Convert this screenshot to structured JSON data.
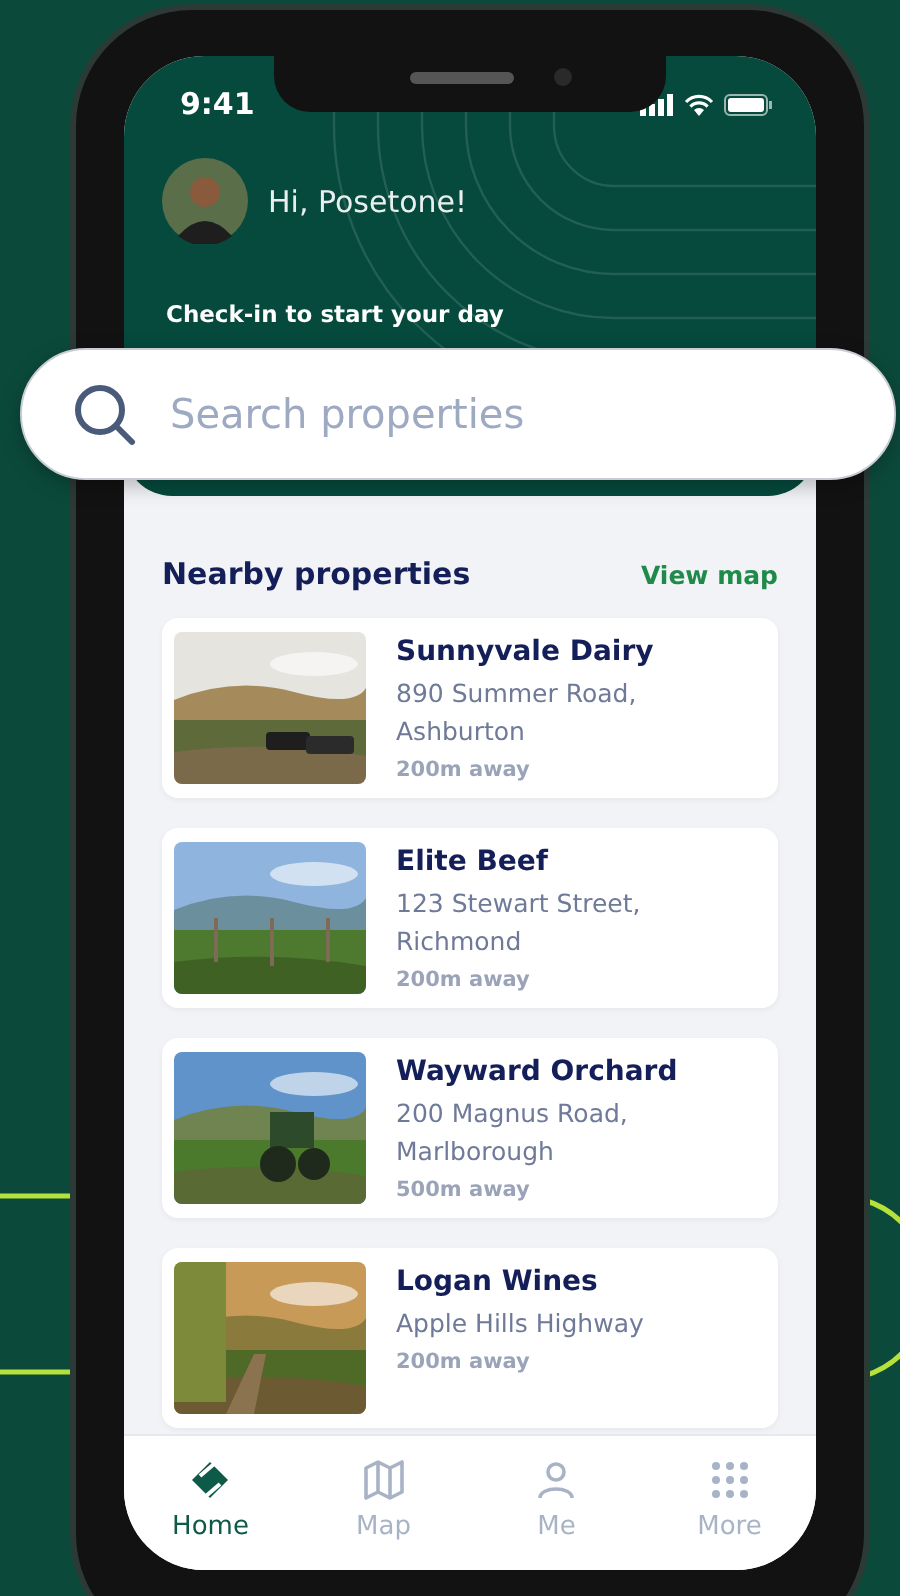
{
  "status_bar": {
    "time": "9:41"
  },
  "header": {
    "greeting": "Hi, Posetone!",
    "subtitle": "Check-in to start your day"
  },
  "search": {
    "placeholder": "Search properties"
  },
  "section": {
    "title": "Nearby properties",
    "link": "View map"
  },
  "properties": [
    {
      "name": "Sunnyvale Dairy",
      "address_lines": [
        "890 Summer Road,",
        "Ashburton"
      ],
      "distance": "200m away",
      "image": {
        "kind": "picture"
      }
    },
    {
      "name": "Elite Beef",
      "address_lines": [
        "123 Stewart Street,",
        "Richmond"
      ],
      "distance": "200m away",
      "image": {
        "kind": "picture"
      }
    },
    {
      "name": "Wayward Orchard",
      "address_lines": [
        "200 Magnus Road,",
        "Marlborough"
      ],
      "distance": "500m away",
      "image": {
        "kind": "picture"
      }
    },
    {
      "name": "Logan Wines",
      "address_lines": [
        "Apple Hills Highway"
      ],
      "distance": "200m away",
      "image": {
        "kind": "picture"
      }
    }
  ],
  "nav": [
    {
      "kind": "home",
      "label": "Home",
      "selected": true
    },
    {
      "kind": "map",
      "label": "Map",
      "selected": false
    },
    {
      "kind": "me",
      "label": "Me",
      "selected": false
    },
    {
      "kind": "more",
      "label": "More",
      "selected": false
    }
  ]
}
